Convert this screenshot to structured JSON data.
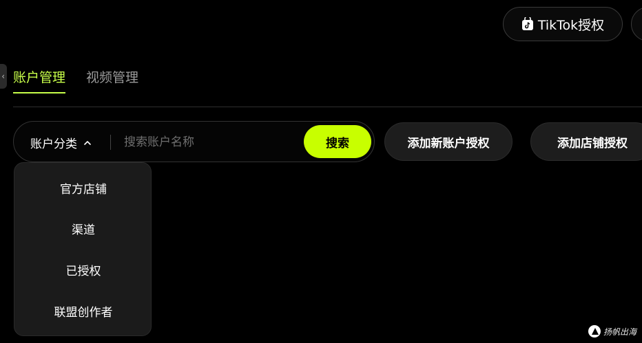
{
  "header": {
    "tiktok_button_label": "TikTok授权"
  },
  "tabs": [
    {
      "label": "账户管理",
      "active": true
    },
    {
      "label": "视频管理",
      "active": false
    }
  ],
  "search": {
    "category_label": "账户分类",
    "placeholder": "搜索账户名称",
    "value": "",
    "button_label": "搜索"
  },
  "actions": {
    "add_account_label": "添加新账户授权",
    "add_store_label": "添加店铺授权"
  },
  "dropdown": {
    "items": [
      "官方店铺",
      "渠道",
      "已授权",
      "联盟创作者"
    ]
  },
  "watermark": {
    "text": "扬帆出海"
  },
  "colors": {
    "accent": "#c8ff00",
    "active_tab": "#c8ff4a",
    "background": "#000000",
    "panel": "#1b1b1b"
  },
  "icons": {
    "tiktok": "tiktok-logo-icon",
    "chevron": "chevron-up-icon",
    "watermark": "yangfan-logo-icon"
  }
}
